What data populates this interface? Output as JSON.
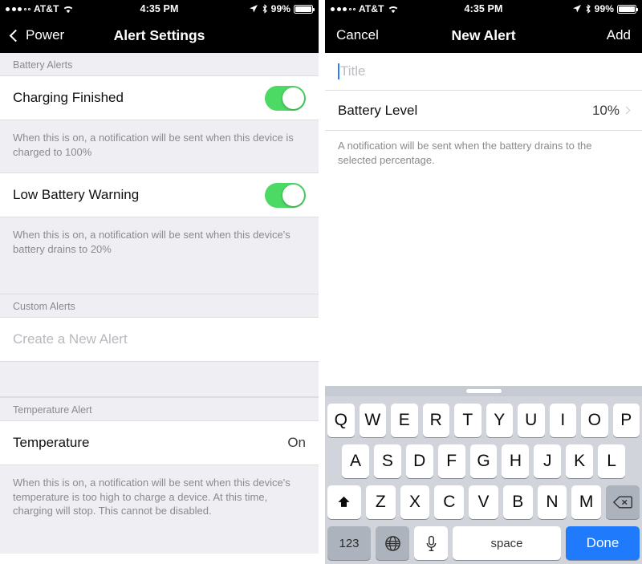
{
  "left_screen": {
    "status_bar": {
      "carrier": "AT&T",
      "signal_filled": 3,
      "signal_hollow": 2,
      "time": "4:35 PM",
      "battery_percent": "99%",
      "icons": [
        "wifi-icon",
        "location-arrow-icon",
        "bluetooth-icon",
        "battery-icon"
      ]
    },
    "nav": {
      "back_label": "Power",
      "title": "Alert Settings"
    },
    "sections": [
      {
        "header": "Battery Alerts",
        "rows": [
          {
            "label": "Charging Finished",
            "control": "switch",
            "value": "on"
          }
        ],
        "footer": "When this is on, a notification will be sent when this device is charged to 100%"
      },
      {
        "header": "",
        "rows": [
          {
            "label": "Low Battery Warning",
            "control": "switch",
            "value": "on"
          }
        ],
        "footer": "When this is on, a notification will be sent when this device's battery drains to 20%"
      },
      {
        "header": "Custom Alerts",
        "rows": [
          {
            "label": "Create a New Alert",
            "control": "none",
            "value": ""
          }
        ],
        "footer": ""
      },
      {
        "header": "Temperature Alert",
        "rows": [
          {
            "label": "Temperature",
            "control": "value",
            "value": "On"
          }
        ],
        "footer": "When this is on, a notification will be sent when this device's temperature is too high to charge a device. At this time, charging will stop. This cannot be disabled."
      }
    ]
  },
  "right_screen": {
    "status_bar": {
      "carrier": "AT&T",
      "signal_filled": 3,
      "signal_hollow": 2,
      "time": "4:35 PM",
      "battery_percent": "99%"
    },
    "nav": {
      "cancel_label": "Cancel",
      "title": "New Alert",
      "add_label": "Add"
    },
    "form": {
      "title_placeholder": "Title",
      "title_value": "",
      "battery_level_label": "Battery Level",
      "battery_level_value": "10%",
      "footer": "A notification will be sent when the battery drains to the selected percentage."
    },
    "keyboard": {
      "row1": [
        "Q",
        "W",
        "E",
        "R",
        "T",
        "Y",
        "U",
        "I",
        "O",
        "P"
      ],
      "row2": [
        "A",
        "S",
        "D",
        "F",
        "G",
        "H",
        "J",
        "K",
        "L"
      ],
      "row3": [
        "Z",
        "X",
        "C",
        "V",
        "B",
        "N",
        "M"
      ],
      "shift_icon": "shift-arrow-icon",
      "backspace_icon": "backspace-icon",
      "numbers_label": "123",
      "globe_icon": "globe-icon",
      "mic_icon": "microphone-icon",
      "space_label": "space",
      "done_label": "Done"
    }
  },
  "colors": {
    "ios_green": "#4cd964",
    "ios_blue": "#1f7bfb",
    "group_bg": "#eeeef3",
    "nav_bg": "#000000",
    "keyboard_bg": "#d1d4da"
  }
}
